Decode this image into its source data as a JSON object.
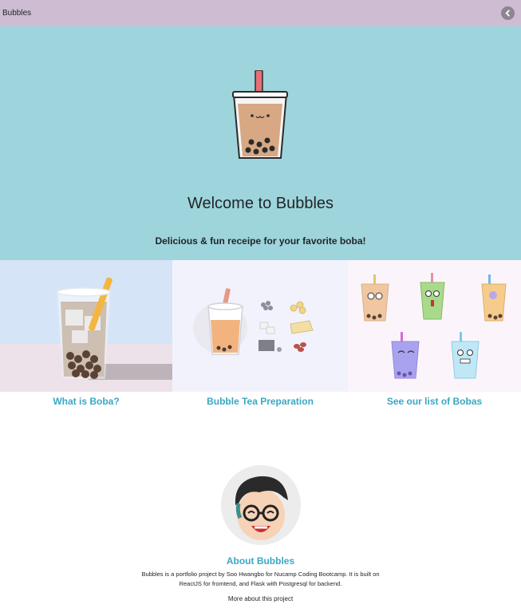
{
  "navbar": {
    "brand": "Bubbles",
    "back_icon": "chevron-left-icon"
  },
  "hero": {
    "title": "Welcome to Bubbles",
    "subtitle": "Delicious & fun receipe for your favorite boba!",
    "background": "#9ed5dc"
  },
  "cards": [
    {
      "label": "What is Boba?"
    },
    {
      "label": "Bubble Tea Preparation"
    },
    {
      "label": "See our list of Bobas"
    }
  ],
  "about": {
    "title": "About Bubbles",
    "description": "Bubbles is a portfolio project by Soo Hwangbo for Nucamp Coding Bootcamp. It is built on ReactJS for fromtend, and Flask with Postgresql for backend.",
    "link": "More about this project"
  },
  "colors": {
    "navbar": "#cdbcd2",
    "accent": "#3aa7c4"
  }
}
